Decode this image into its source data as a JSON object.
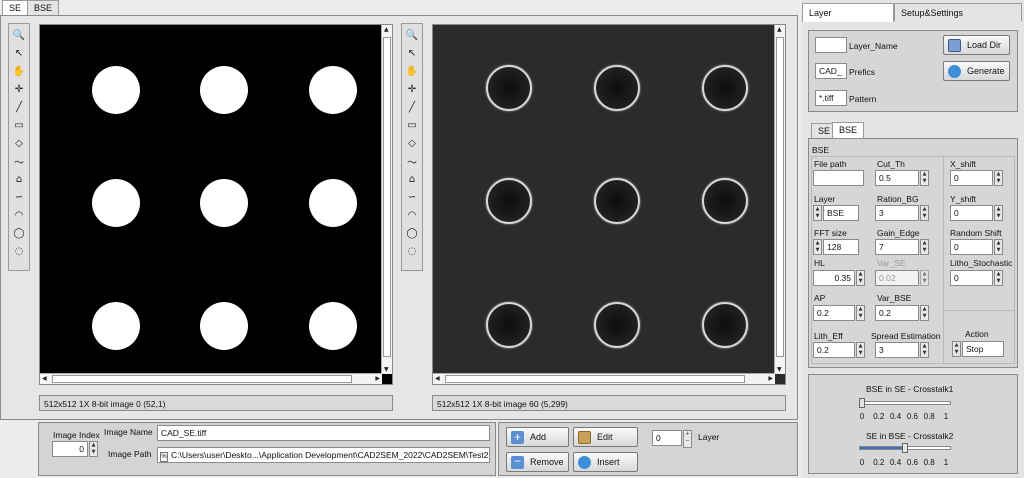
{
  "left_tabs": [
    "SE",
    "BSE"
  ],
  "tools": [
    "zoom-icon",
    "pointer-icon",
    "hand-icon",
    "crosshair-icon",
    "line-icon",
    "rectangle-icon",
    "rotated-rect-icon",
    "freehand-icon",
    "polygon-icon",
    "polyline-icon",
    "freeform-icon",
    "oval-icon",
    "annulus-icon"
  ],
  "tool_glyphs": [
    "🔍",
    "↖",
    "✋",
    "✛",
    "╱",
    "▭",
    "◇",
    "〜",
    "⌂",
    "∽",
    "◠",
    "◯",
    "◌"
  ],
  "viewer_left": {
    "status": "512x512 1X 8-bit image 0    (52,1)"
  },
  "viewer_right": {
    "status": "512x512 1X 8-bit image 60    (5,299)"
  },
  "bottom": {
    "image_index_label": "Image Index",
    "image_index_value": "0",
    "image_name_label": "Image Name",
    "image_name_value": "CAD_SE.tiff",
    "image_path_label": "Image Path",
    "image_path_value": "C:\\Users\\user\\Deskto...\\Application Development\\CAD2SEM_2022\\CAD2SEM\\Test2",
    "add_label": "Add",
    "edit_label": "Edit",
    "remove_label": "Remove",
    "insert_label": "Insert",
    "layer_value": "0",
    "layer_label": "Layer"
  },
  "right_tabs": [
    "Layer",
    "Setup&Settings"
  ],
  "layer_panel": {
    "layer_name_label": "Layer_Name",
    "layer_name_value": "",
    "prefics_label": "Prefics",
    "prefics_value": "CAD_",
    "pattern_label": "Pattern",
    "pattern_value": "*.tiff",
    "load_dir_label": "Load Dir",
    "generate_label": "Generate"
  },
  "param_tabs": [
    "SE",
    "BSE"
  ],
  "params": {
    "section_title": "BSE",
    "file_path_label": "File path",
    "file_path_value": "",
    "layer_label": "Layer",
    "layer_value": "BSE",
    "fft_label": "FFT size",
    "fft_value": "128",
    "hl_label": "HL",
    "hl_value": "0.35",
    "ap_label": "AP",
    "ap_value": "0.2",
    "lith_eff_label": "Lith_Eff",
    "lith_eff_value": "0.2",
    "cut_th_label": "Cut_Th",
    "cut_th_value": "0.5",
    "ration_bg_label": "Ration_BG",
    "ration_bg_value": "3",
    "gain_edge_label": "Gain_Edge",
    "gain_edge_value": "7",
    "var_se_label": "Var_SE",
    "var_se_value": "0.02",
    "var_bse_label": "Var_BSE",
    "var_bse_value": "0.2",
    "spread_label": "Spread Estimation",
    "spread_value": "3",
    "x_shift_label": "X_shift",
    "x_shift_value": "0",
    "y_shift_label": "Y_shift",
    "y_shift_value": "0",
    "random_shift_label": "Random Shift",
    "random_shift_value": "0",
    "litho_label": "Litho_Stochastic",
    "litho_value": "0",
    "action_label": "Action",
    "action_value": "Stop"
  },
  "crosstalk": {
    "bse_in_se_label": "BSE in SE - Crosstalk1",
    "bse_in_se_value": 0.02,
    "se_in_bse_label": "SE in BSE - Crosstalk2",
    "se_in_bse_value": 0.5,
    "ticks": [
      "0",
      "0.2",
      "0.4",
      "0.6",
      "0.8",
      "1"
    ]
  }
}
